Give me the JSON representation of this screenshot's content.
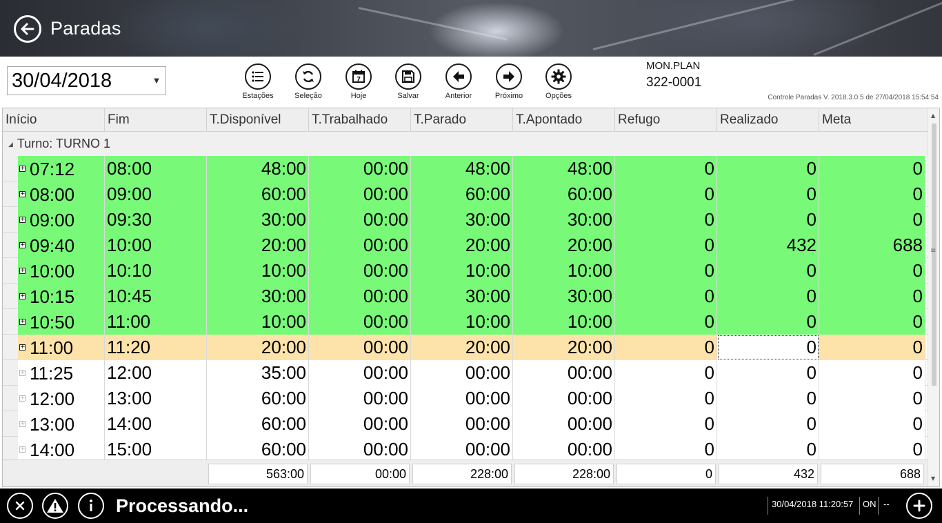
{
  "header": {
    "title": "Paradas"
  },
  "toolbar": {
    "date": "30/04/2018",
    "buttons": [
      {
        "label": "Estações",
        "icon": "list-icon"
      },
      {
        "label": "Seleção",
        "icon": "refresh-icon"
      },
      {
        "label": "Hoje",
        "icon": "calendar-icon"
      },
      {
        "label": "Salvar",
        "icon": "save-icon"
      },
      {
        "label": "Anterior",
        "icon": "arrow-left-icon"
      },
      {
        "label": "Próximo",
        "icon": "arrow-right-icon"
      },
      {
        "label": "Opções",
        "icon": "gear-icon"
      }
    ],
    "mon_label": "MON.PLAN",
    "mon_value": "322-0001",
    "version": "Controle Paradas V. 2018.3.0.5 de 27/04/2018 15:54:54"
  },
  "grid": {
    "columns": [
      "Início",
      "Fim",
      "T.Disponível",
      "T.Trabalhado",
      "T.Parado",
      "T.Apontado",
      "Refugo",
      "Realizado",
      "Meta"
    ],
    "group_label": "Turno: TURNO 1",
    "rows": [
      {
        "status": "green",
        "cells": [
          "07:12",
          "08:00",
          "48:00",
          "00:00",
          "48:00",
          "48:00",
          "0",
          "0",
          "0"
        ]
      },
      {
        "status": "green",
        "cells": [
          "08:00",
          "09:00",
          "60:00",
          "00:00",
          "60:00",
          "60:00",
          "0",
          "0",
          "0"
        ]
      },
      {
        "status": "green",
        "cells": [
          "09:00",
          "09:30",
          "30:00",
          "00:00",
          "30:00",
          "30:00",
          "0",
          "0",
          "0"
        ]
      },
      {
        "status": "green",
        "cells": [
          "09:40",
          "10:00",
          "20:00",
          "00:00",
          "20:00",
          "20:00",
          "0",
          "432",
          "688"
        ]
      },
      {
        "status": "green",
        "cells": [
          "10:00",
          "10:10",
          "10:00",
          "00:00",
          "10:00",
          "10:00",
          "0",
          "0",
          "0"
        ]
      },
      {
        "status": "green",
        "cells": [
          "10:15",
          "10:45",
          "30:00",
          "00:00",
          "30:00",
          "30:00",
          "0",
          "0",
          "0"
        ]
      },
      {
        "status": "green",
        "cells": [
          "10:50",
          "11:00",
          "10:00",
          "00:00",
          "10:00",
          "10:00",
          "0",
          "0",
          "0"
        ]
      },
      {
        "status": "orange",
        "cells": [
          "11:00",
          "11:20",
          "20:00",
          "00:00",
          "20:00",
          "20:00",
          "0",
          "0",
          "0"
        ]
      },
      {
        "status": "white",
        "cells": [
          "11:25",
          "12:00",
          "35:00",
          "00:00",
          "00:00",
          "00:00",
          "0",
          "0",
          "0"
        ]
      },
      {
        "status": "white",
        "cells": [
          "12:00",
          "13:00",
          "60:00",
          "00:00",
          "00:00",
          "00:00",
          "0",
          "0",
          "0"
        ]
      },
      {
        "status": "white",
        "cells": [
          "13:00",
          "14:00",
          "60:00",
          "00:00",
          "00:00",
          "00:00",
          "0",
          "0",
          "0"
        ]
      },
      {
        "status": "white",
        "cells": [
          "14:00",
          "15:00",
          "60:00",
          "00:00",
          "00:00",
          "00:00",
          "0",
          "0",
          "0"
        ]
      }
    ],
    "totals": [
      "563:00",
      "00:00",
      "228:00",
      "228:00",
      "0",
      "432",
      "688"
    ],
    "row_colors": {
      "green": "#78fa78",
      "orange": "#fde3aa",
      "white": "#ffffff"
    }
  },
  "statusbar": {
    "message": "Processando...",
    "datetime": "30/04/2018 11:20:57",
    "state": "ON",
    "extra": "--",
    "buttons": [
      {
        "icon": "close-icon"
      },
      {
        "icon": "warning-icon"
      },
      {
        "icon": "info-icon"
      },
      {
        "icon": "plus-icon"
      }
    ]
  }
}
